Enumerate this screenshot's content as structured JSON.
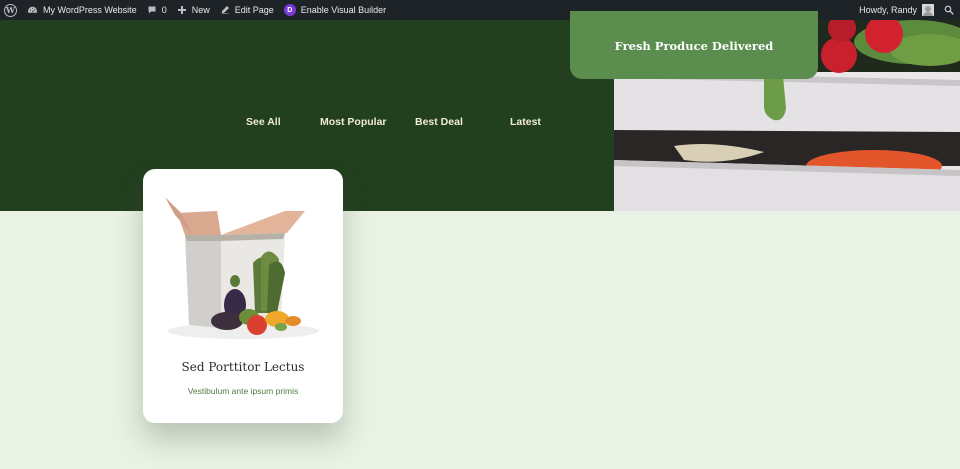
{
  "admin_bar": {
    "site_name": "My WordPress Website",
    "comments_count": "0",
    "new_label": "New",
    "edit_page_label": "Edit Page",
    "visual_builder_label": "Enable Visual Builder",
    "divi_badge": "D",
    "howdy_label": "Howdy, Randy",
    "wp_logo_glyph": "W"
  },
  "hero": {
    "tabs": [
      "See All",
      "Most Popular",
      "Best Deal",
      "Latest"
    ],
    "cta_label": "Fresh Produce Delivered"
  },
  "product_card": {
    "title": "Sed Porttitor Lectus",
    "subtitle": "Vestibulum ante ipsum primis"
  },
  "colors": {
    "admin_bar": "#1d2327",
    "hero_bg": "#223f1f",
    "page_bg": "#e9f2e4",
    "cta_bg": "#5b8d4f",
    "tab_text": "#f1ecd2",
    "subtitle_text": "#4f7d3f",
    "divi_purple": "#7b3bd9"
  },
  "icons": [
    "wordpress-logo-icon",
    "dashboard-icon",
    "comment-icon",
    "plus-icon",
    "pencil-icon",
    "divi-icon",
    "avatar",
    "search-icon"
  ]
}
